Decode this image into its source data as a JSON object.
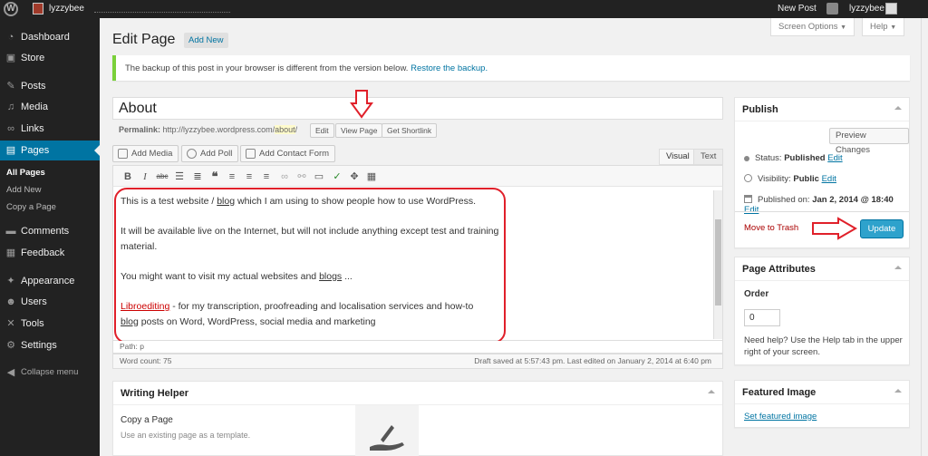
{
  "admin_bar": {
    "site_name": "lyzzybee",
    "new_post": "New Post",
    "user": "lyzzybee"
  },
  "sidebar": {
    "items": [
      {
        "label": "Dashboard",
        "icon": "dashboard-icon"
      },
      {
        "label": "Store",
        "icon": "store-icon"
      },
      {
        "label": "Posts",
        "icon": "pin-icon"
      },
      {
        "label": "Media",
        "icon": "media-icon"
      },
      {
        "label": "Links",
        "icon": "link-icon"
      },
      {
        "label": "Pages",
        "icon": "pages-icon"
      },
      {
        "label": "Comments",
        "icon": "comments-icon"
      },
      {
        "label": "Feedback",
        "icon": "feedback-icon"
      },
      {
        "label": "Appearance",
        "icon": "appearance-icon"
      },
      {
        "label": "Users",
        "icon": "users-icon"
      },
      {
        "label": "Tools",
        "icon": "tools-icon"
      },
      {
        "label": "Settings",
        "icon": "settings-icon"
      }
    ],
    "submenu": [
      "All Pages",
      "Add New",
      "Copy a Page"
    ],
    "collapse": "Collapse menu"
  },
  "header": {
    "title": "Edit Page",
    "add_new": "Add New",
    "screen_options": "Screen Options",
    "help": "Help"
  },
  "notice": {
    "text": "The backup of this post in your browser is different from the version below.",
    "link": "Restore the backup."
  },
  "editor": {
    "title": "About",
    "permalink_label": "Permalink:",
    "permalink_base": "http://lyzzybee.wordpress.com/",
    "permalink_slug": "about",
    "permalink_tail": "/",
    "edit_btn": "Edit",
    "view_page": "View Page",
    "get_shortlink": "Get Shortlink",
    "add_media": "Add Media",
    "add_poll": "Add Poll",
    "add_contact_form": "Add Contact Form",
    "tab_visual": "Visual",
    "tab_text": "Text",
    "content": {
      "p1_a": "This is a test website / ",
      "p1_b": "blog",
      "p1_c": " which I am using to show people how to use WordPress.",
      "p2_a": "It will be available live on the Internet, but will not include anything except test and training",
      "p2_b": "material.",
      "p3_a": "You might want to visit my actual websites and ",
      "p3_b": "blogs",
      "p3_c": " ...",
      "p4_a": "Libroediting",
      "p4_b": " - for my transcription, proofreading and localisation services and how-to",
      "p4_c": "blog",
      "p4_d": " posts on Word, WordPress, social media and marketing"
    },
    "path": "Path: p",
    "word_count": "Word count: 75",
    "draft_saved": "Draft saved at 5:57:43 pm. Last edited on January 2, 2014 at 6:40 pm"
  },
  "writing_helper": {
    "title": "Writing Helper",
    "copy_title": "Copy a Page",
    "copy_desc": "Use an existing page as a template."
  },
  "publish": {
    "title": "Publish",
    "preview": "Preview Changes",
    "status_label": "Status:",
    "status_value": "Published",
    "visibility_label": "Visibility:",
    "visibility_value": "Public",
    "published_label": "Published on:",
    "published_value": "Jan 2, 2014 @ 18:40",
    "edit": "Edit",
    "trash": "Move to Trash",
    "update": "Update"
  },
  "page_attributes": {
    "title": "Page Attributes",
    "order_label": "Order",
    "order_value": "0",
    "help": "Need help? Use the Help tab in the upper right of your screen."
  },
  "featured_image": {
    "title": "Featured Image",
    "link": "Set featured image"
  },
  "colors": {
    "accent": "#0074a2",
    "sidebar": "#222222",
    "update": "#2ea2cc",
    "annotation": "#e0202a"
  }
}
